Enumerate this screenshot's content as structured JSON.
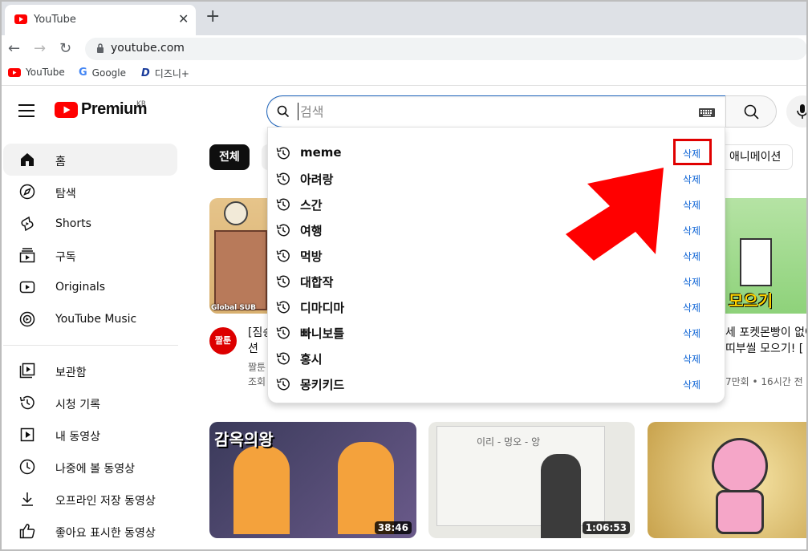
{
  "browser": {
    "tab_title": "YouTube",
    "url": "youtube.com",
    "bookmarks": [
      {
        "label": "YouTube",
        "icon": "youtube-icon"
      },
      {
        "label": "Google",
        "icon": "google-icon"
      },
      {
        "label": "디즈니+",
        "icon": "disney-plus-icon"
      }
    ]
  },
  "header": {
    "logo_text": "Premium",
    "logo_region": "KR",
    "search_placeholder": "검색",
    "search_value": ""
  },
  "sidebar": {
    "items": [
      {
        "label": "홈",
        "icon": "home-icon",
        "active": true
      },
      {
        "label": "탐색",
        "icon": "compass-icon"
      },
      {
        "label": "Shorts",
        "icon": "shorts-icon"
      },
      {
        "label": "구독",
        "icon": "subscriptions-icon"
      },
      {
        "label": "Originals",
        "icon": "originals-icon"
      },
      {
        "label": "YouTube Music",
        "icon": "music-icon"
      },
      {
        "label": "보관함",
        "icon": "library-icon"
      },
      {
        "label": "시청 기록",
        "icon": "history-icon"
      },
      {
        "label": "내 동영상",
        "icon": "my-videos-icon"
      },
      {
        "label": "나중에 볼 동영상",
        "icon": "watch-later-icon"
      },
      {
        "label": "오프라인 저장 동영상",
        "icon": "download-icon"
      },
      {
        "label": "좋아요 표시한 동영상",
        "icon": "like-icon"
      }
    ]
  },
  "chips": {
    "all": "전체",
    "animation": "애니메이션"
  },
  "suggestions": {
    "delete_label": "삭제",
    "items": [
      "meme",
      "아려랑",
      "스간",
      "여행",
      "먹방",
      "대합작",
      "디마디마",
      "빠니보틀",
      "홍시",
      "몽키키드"
    ]
  },
  "videos": {
    "row1_left": {
      "badge": "Global SUB",
      "title_line1": "[짐승",
      "title_line2": "션",
      "channel": "짤툰",
      "meta": "조회"
    },
    "row1_right": {
      "title_line1": "세 포켓몬빵이 없어",
      "title_line2": "띠부씰 모으기! [",
      "meta": "7만회 • 16시간 전",
      "thumb_text": "모으기"
    },
    "row2": [
      {
        "duration": "38:46",
        "thumb_text": "감옥의왕"
      },
      {
        "duration": "1:06:53",
        "thumb_text": "이리 - 멍오 - 앙"
      },
      {
        "duration": ""
      }
    ]
  },
  "colors": {
    "brand_red": "#ff0000",
    "link_blue": "#065fd4",
    "highlight_red": "#e00000"
  }
}
